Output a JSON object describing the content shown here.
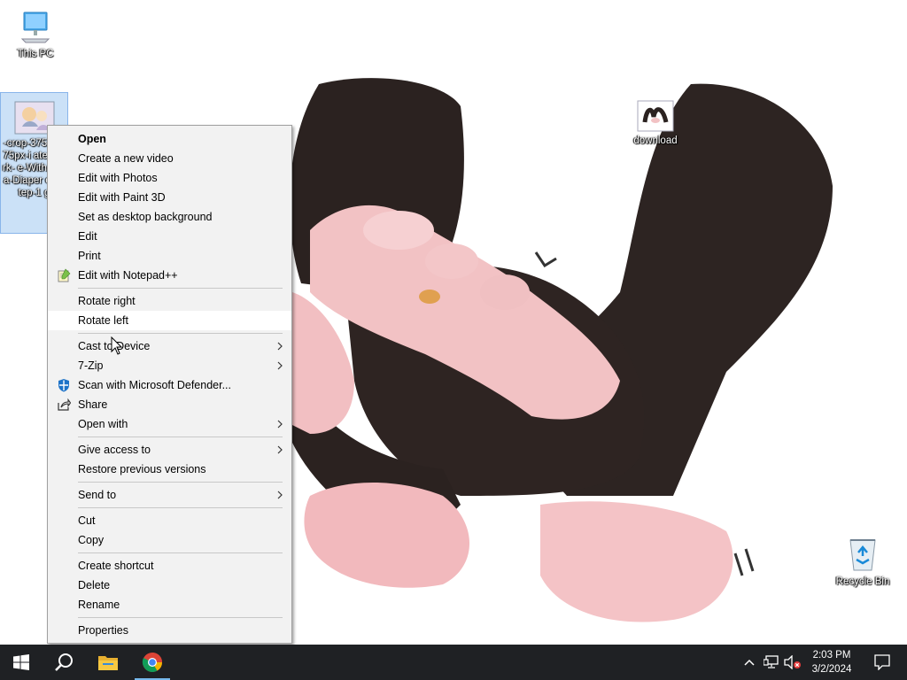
{
  "desktop": {
    "icons": {
      "this_pc": "This PC",
      "file": "-crop-375-0-375px-Watermark-Be-With-Baby-a-Diaper-Her-Step-1-Jpg",
      "file_display": "-crop-375 0-375px-i atermark- e-With-Bi -a-Diaper er-Step-1 g",
      "download": "download",
      "recycle_bin": "Recycle Bin"
    }
  },
  "context_menu": {
    "items": [
      {
        "label": "Open",
        "bold": true
      },
      {
        "label": "Create a new video"
      },
      {
        "label": "Edit with Photos"
      },
      {
        "label": "Edit with Paint 3D"
      },
      {
        "label": "Set as desktop background"
      },
      {
        "label": "Edit"
      },
      {
        "label": "Print"
      },
      {
        "label": "Edit with Notepad++",
        "icon": "notepad-plus-plus-icon"
      },
      {
        "separator": true
      },
      {
        "label": "Rotate right"
      },
      {
        "label": "Rotate left",
        "hover": true
      },
      {
        "separator": true
      },
      {
        "label": "Cast to Device",
        "submenu": true
      },
      {
        "label": "7-Zip",
        "submenu": true
      },
      {
        "label": "Scan with Microsoft Defender...",
        "icon": "defender-shield-icon"
      },
      {
        "label": "Share",
        "icon": "share-icon"
      },
      {
        "label": "Open with",
        "submenu": true
      },
      {
        "separator": true
      },
      {
        "label": "Give access to",
        "submenu": true
      },
      {
        "label": "Restore previous versions"
      },
      {
        "separator": true
      },
      {
        "label": "Send to",
        "submenu": true
      },
      {
        "separator": true
      },
      {
        "label": "Cut"
      },
      {
        "label": "Copy"
      },
      {
        "separator": true
      },
      {
        "label": "Create shortcut"
      },
      {
        "label": "Delete"
      },
      {
        "label": "Rename"
      },
      {
        "separator": true
      },
      {
        "label": "Properties"
      }
    ]
  },
  "taskbar": {
    "apps": [
      {
        "name": "start",
        "icon": "windows-logo-icon"
      },
      {
        "name": "search",
        "icon": "search-icon"
      },
      {
        "name": "file-explorer",
        "icon": "folder-icon"
      },
      {
        "name": "google-chrome",
        "icon": "chrome-icon"
      }
    ],
    "clock": {
      "time": "2:03 PM",
      "date": "3/2/2024"
    }
  },
  "colors": {
    "taskbar": "#1f2124",
    "menu_bg": "#f2f2f2",
    "menu_hover": "#ffffff",
    "separator": "#c8c8c8",
    "accent": "#76b9ed"
  }
}
